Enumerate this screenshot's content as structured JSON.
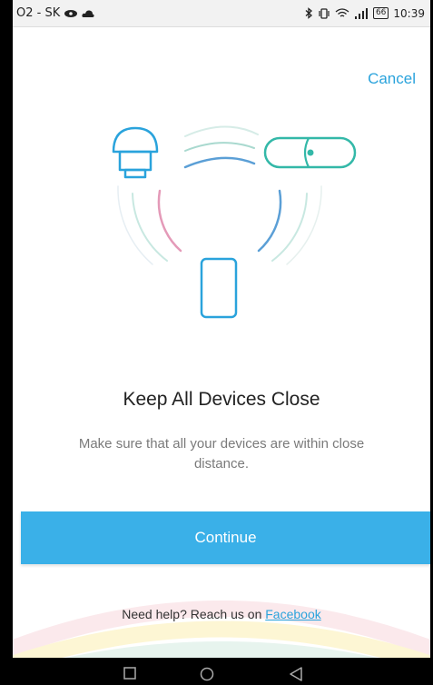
{
  "status_bar": {
    "carrier": "O2 - SK",
    "battery": "66",
    "time": "10:39"
  },
  "header": {
    "cancel_label": "Cancel"
  },
  "content": {
    "title": "Keep All Devices Close",
    "description": "Make sure that all your devices are within close distance."
  },
  "actions": {
    "continue_label": "Continue"
  },
  "help": {
    "prefix": "Need help? Reach us on ",
    "link": "Facebook"
  },
  "colors": {
    "accent": "#3ab0e8",
    "link": "#2aa3dc"
  },
  "icons": [
    "bluetooth-icon",
    "vibrate-icon",
    "wifi-icon",
    "signal-icon",
    "battery-icon",
    "obd-adapter-icon",
    "tracker-icon",
    "phone-icon",
    "recent-apps-icon",
    "home-icon",
    "back-icon"
  ]
}
